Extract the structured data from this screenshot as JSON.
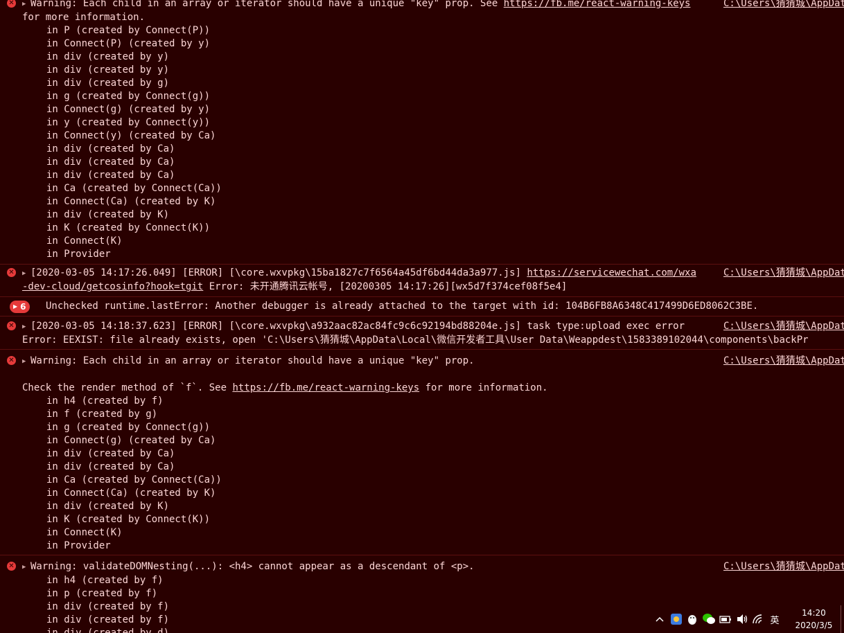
{
  "console": {
    "entries": [
      {
        "type": "error",
        "lines": [
          "Warning: Each child in an array or iterator should have a unique \"key\" prop. See ",
          "https://fb.me/react-warning-keys",
          "for more information."
        ],
        "stack": [
          "in P (created by Connect(P))",
          "in Connect(P) (created by y)",
          "in div (created by y)",
          "in div (created by y)",
          "in div (created by g)",
          "in g (created by Connect(g))",
          "in Connect(g) (created by y)",
          "in y (created by Connect(y))",
          "in Connect(y) (created by Ca)",
          "in div (created by Ca)",
          "in div (created by Ca)",
          "in div (created by Ca)",
          "in Ca (created by Connect(Ca))",
          "in Connect(Ca) (created by K)",
          "in div (created by K)",
          "in K (created by Connect(K))",
          "in Connect(K)",
          "in Provider"
        ],
        "source": "C:\\Users\\猜猜城\\AppData"
      },
      {
        "type": "error",
        "prefix": "[2020-03-05 14:17:26.049] [ERROR] [\\core.wxvpkg\\15ba1827c7f6564a45df6bd44da3a977.js] ",
        "link1": "https://servicewechat.com/wxa",
        "link2": "-dev-cloud/getcosinfo?hook=tgit",
        "suffix": " Error: 未开通腾讯云帐号, [20200305 14:17:26][wx5d7f374cef08f5e4]",
        "source": "C:\\Users\\猜猜城\\AppData"
      },
      {
        "type": "grouped",
        "count": "6",
        "text": "Unchecked runtime.lastError: Another debugger is already attached to the target with id: 104B6FB8A6348C417499D6ED8062C3BE."
      },
      {
        "type": "error",
        "line1": "[2020-03-05 14:18:37.623] [ERROR] [\\core.wxvpkg\\a932aac82ac84fc9c6c92194bd88204e.js] task type:upload exec error",
        "line2": "Error: EEXIST: file already exists, open 'C:\\Users\\猜猜城\\AppData\\Local\\微信开发者工具\\User Data\\Weappdest\\1583389102044\\components\\backPr",
        "source": "C:\\Users\\猜猜城\\AppData"
      },
      {
        "type": "error",
        "line1": "Warning: Each child in an array or iterator should have a unique \"key\" prop.",
        "check_prefix": "Check the render method of `f`. See ",
        "check_link": "https://fb.me/react-warning-keys",
        "check_suffix": " for more information.",
        "stack": [
          "in h4 (created by f)",
          "in f (created by g)",
          "in g (created by Connect(g))",
          "in Connect(g) (created by Ca)",
          "in div (created by Ca)",
          "in div (created by Ca)",
          "in Ca (created by Connect(Ca))",
          "in Connect(Ca) (created by K)",
          "in div (created by K)",
          "in K (created by Connect(K))",
          "in Connect(K)",
          "in Provider"
        ],
        "source": "C:\\Users\\猜猜城\\AppData"
      },
      {
        "type": "error",
        "line1": "Warning: validateDOMNesting(...): <h4> cannot appear as a descendant of <p>.",
        "stack": [
          "in h4 (created by f)",
          "in p (created by f)",
          "in div (created by f)",
          "in div (created by f)",
          "in div (created by d)"
        ],
        "source": "C:\\Users\\猜猜城\\AppData"
      }
    ]
  },
  "taskbar": {
    "ime_label": "英",
    "time": "14:20",
    "date": "2020/3/5"
  },
  "colors": {
    "background": "#290000",
    "text": "#fcd6d6",
    "error_icon": "#e63a3a"
  }
}
